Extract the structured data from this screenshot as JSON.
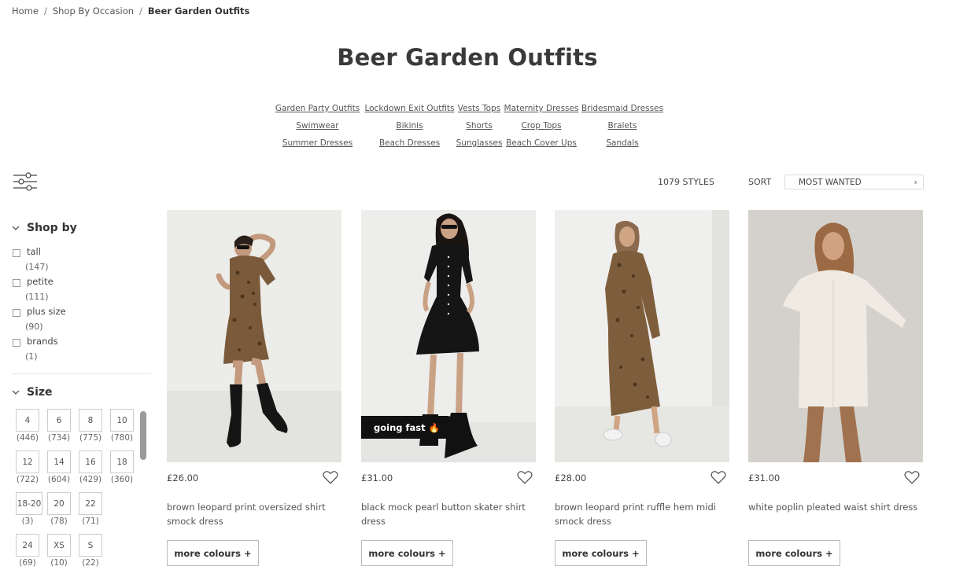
{
  "breadcrumb": {
    "items": [
      "Home",
      "Shop By Occasion"
    ],
    "current": "Beer Garden Outfits",
    "separator": "/"
  },
  "page_title": "Beer Garden Outfits",
  "quick_links": [
    "Garden Party Outfits",
    "Lockdown Exit Outfits",
    "Vests Tops",
    "Maternity Dresses",
    "Bridesmaid Dresses",
    "Swimwear",
    "Bikinis",
    "Shorts",
    "Crop Tops",
    "Bralets",
    "Summer Dresses",
    "Beach Dresses",
    "Sunglasses",
    "Beach Cover Ups",
    "Sandals"
  ],
  "toolbar": {
    "filter_icon": "sliders-icon",
    "count": "1079 STYLES",
    "sort_label": "SORT",
    "sort_value": "MOST WANTED"
  },
  "sidebar": {
    "shop_by": {
      "title": "Shop by",
      "options": [
        {
          "label": "tall",
          "count": "(147)"
        },
        {
          "label": "petite",
          "count": "(111)"
        },
        {
          "label": "plus size",
          "count": "(90)"
        },
        {
          "label": "brands",
          "count": "(1)"
        }
      ]
    },
    "size": {
      "title": "Size",
      "options": [
        {
          "label": "4",
          "count": "(446)"
        },
        {
          "label": "6",
          "count": "(734)"
        },
        {
          "label": "8",
          "count": "(775)"
        },
        {
          "label": "10",
          "count": "(780)"
        },
        {
          "label": "12",
          "count": "(722)"
        },
        {
          "label": "14",
          "count": "(604)"
        },
        {
          "label": "16",
          "count": "(429)"
        },
        {
          "label": "18",
          "count": "(360)"
        },
        {
          "label": "18-20",
          "count": "(3)"
        },
        {
          "label": "20",
          "count": "(78)"
        },
        {
          "label": "22",
          "count": "(71)"
        },
        {
          "label": "24",
          "count": "(69)"
        },
        {
          "label": "XS",
          "count": "(10)"
        },
        {
          "label": "S",
          "count": "(22)"
        }
      ]
    }
  },
  "products": [
    {
      "price": "£26.00",
      "name": "brown leopard print oversized shirt smock dress",
      "button": "more colours +",
      "badge": ""
    },
    {
      "price": "£31.00",
      "name": "black mock pearl button skater shirt dress",
      "button": "more colours +",
      "badge": "going fast 🔥"
    },
    {
      "price": "£28.00",
      "name": "brown leopard print ruffle hem midi smock dress",
      "button": "more colours +",
      "badge": ""
    },
    {
      "price": "£31.00",
      "name": "white poplin pleated waist shirt dress",
      "button": "more colours +",
      "badge": ""
    }
  ],
  "colors": {
    "leopard": "#7a5a3a",
    "black_dress": "#151515",
    "white_dress": "#eeeae2",
    "photo_bg": "#ececea"
  }
}
